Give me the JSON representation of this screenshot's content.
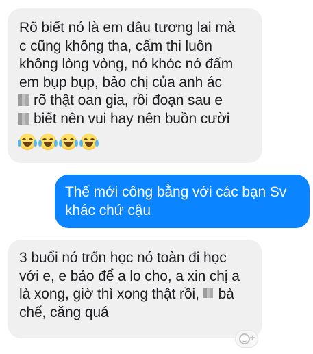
{
  "messages": [
    {
      "direction": "incoming",
      "lines": [
        "Rõ biết nó là em dâu tương lai mà",
        "c cũng không tha, cấm thi luôn",
        "không lòng vòng, nó khóc nó đấm",
        "em bụp bụp, bảo chị của anh ác",
        "rõ thật oan gia, rồi đoạn sau e",
        "biết nên vui hay nên buồn cười"
      ],
      "emoji": [
        "face-with-tears-of-joy-icon",
        "face-with-tears-of-joy-icon",
        "face-with-tears-of-joy-icon",
        "face-with-tears-of-joy-icon"
      ]
    },
    {
      "direction": "outgoing",
      "lines": [
        "Thế mới công bằng với các bạn Sv",
        "khác chứ cậu"
      ]
    },
    {
      "direction": "incoming",
      "lines": [
        "3 buổi nó trốn học nó toàn đi học",
        "với e, e bảo để a lo cho, a xin chị a",
        "là xong, giờ thì xong thật rồi,",
        "bà",
        "chế, căng quá"
      ]
    }
  ],
  "reaction_button": {
    "icon": "add-reaction-icon",
    "symbol": "+"
  },
  "colors": {
    "incoming_bubble": "#f1f0f0",
    "outgoing_bubble": "#0a84ff",
    "outgoing_text": "#ffffff",
    "incoming_text": "#1c1e21"
  }
}
